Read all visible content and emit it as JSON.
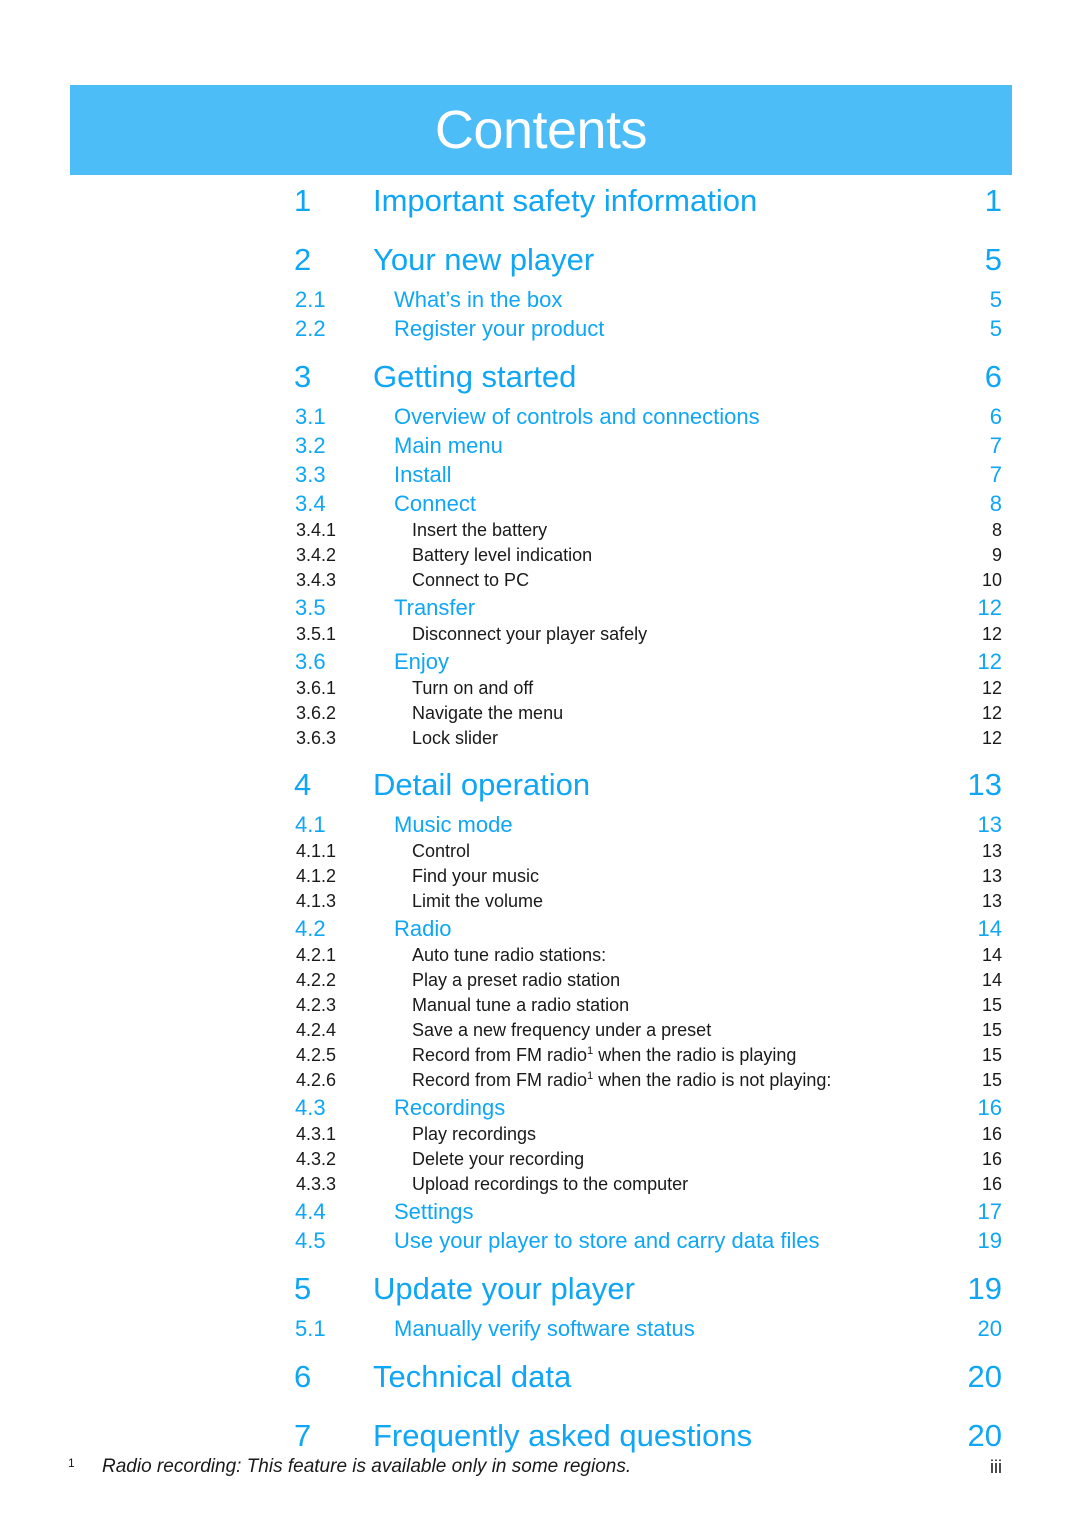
{
  "header": {
    "title": "Contents",
    "band_color": "#4dbdf7",
    "title_color": "#ffffff"
  },
  "colors": {
    "accent_blue": "#0fa6f5",
    "header_blue": "#4dbdf7",
    "body_black": "#1a1a1a"
  },
  "toc": {
    "entries": [
      {
        "level": 1,
        "number": "1",
        "label": "Important safety information",
        "page": "1",
        "gap_before": false
      },
      {
        "level": 1,
        "number": "2",
        "label": "Your new player",
        "page": "5",
        "gap_before": true
      },
      {
        "level": 2,
        "number": "2.1",
        "label": "What’s in the box",
        "page": "5",
        "gap_before": false
      },
      {
        "level": 2,
        "number": "2.2",
        "label": "Register your product",
        "page": "5",
        "gap_before": false
      },
      {
        "level": 1,
        "number": "3",
        "label": "Getting started",
        "page": "6",
        "gap_before": true
      },
      {
        "level": 2,
        "number": "3.1",
        "label": "Overview of controls and connections",
        "page": "6",
        "gap_before": false
      },
      {
        "level": 2,
        "number": "3.2",
        "label": "Main menu",
        "page": "7",
        "gap_before": false
      },
      {
        "level": 2,
        "number": "3.3",
        "label": "Install",
        "page": "7",
        "gap_before": false
      },
      {
        "level": 2,
        "number": "3.4",
        "label": "Connect",
        "page": "8",
        "gap_before": false
      },
      {
        "level": 3,
        "number": "3.4.1",
        "label": "Insert the battery",
        "page": "8",
        "gap_before": false
      },
      {
        "level": 3,
        "number": "3.4.2",
        "label": "Battery level indication",
        "page": "9",
        "gap_before": false
      },
      {
        "level": 3,
        "number": "3.4.3",
        "label": "Connect to PC",
        "page": "10",
        "gap_before": false
      },
      {
        "level": 2,
        "number": "3.5",
        "label": "Transfer",
        "page": "12",
        "gap_before": false
      },
      {
        "level": 3,
        "number": "3.5.1",
        "label": "Disconnect your player safely",
        "page": "12",
        "gap_before": false
      },
      {
        "level": 2,
        "number": "3.6",
        "label": "Enjoy",
        "page": "12",
        "gap_before": false
      },
      {
        "level": 3,
        "number": "3.6.1",
        "label": "Turn on and off",
        "page": "12",
        "gap_before": false
      },
      {
        "level": 3,
        "number": "3.6.2",
        "label": "Navigate the menu",
        "page": "12",
        "gap_before": false
      },
      {
        "level": 3,
        "number": "3.6.3",
        "label": "Lock slider",
        "page": "12",
        "gap_before": false
      },
      {
        "level": 1,
        "number": "4",
        "label": "Detail operation",
        "page": "13",
        "gap_before": true
      },
      {
        "level": 2,
        "number": "4.1",
        "label": "Music mode",
        "page": "13",
        "gap_before": false
      },
      {
        "level": 3,
        "number": "4.1.1",
        "label": "Control",
        "page": "13",
        "gap_before": false
      },
      {
        "level": 3,
        "number": "4.1.2",
        "label": "Find your music",
        "page": "13",
        "gap_before": false
      },
      {
        "level": 3,
        "number": "4.1.3",
        "label": "Limit the volume",
        "page": "13",
        "gap_before": false
      },
      {
        "level": 2,
        "number": "4.2",
        "label": "Radio",
        "page": "14",
        "gap_before": false
      },
      {
        "level": 3,
        "number": "4.2.1",
        "label": "Auto tune radio stations:",
        "page": "14",
        "gap_before": false
      },
      {
        "level": 3,
        "number": "4.2.2",
        "label": "Play a preset radio station",
        "page": "14",
        "gap_before": false
      },
      {
        "level": 3,
        "number": "4.2.3",
        "label": "Manual tune a radio station",
        "page": "15",
        "gap_before": false
      },
      {
        "level": 3,
        "number": "4.2.4",
        "label": "Save a new frequency under a preset",
        "page": "15",
        "gap_before": false
      },
      {
        "level": 3,
        "number": "4.2.5",
        "label": "Record from FM radio",
        "footnote": "1",
        "label_after": " when the radio is playing",
        "page": "15",
        "gap_before": false
      },
      {
        "level": 3,
        "number": "4.2.6",
        "label": "Record from FM radio",
        "footnote": "1",
        "label_after": " when the radio is not playing:",
        "page": "15",
        "gap_before": false
      },
      {
        "level": 2,
        "number": "4.3",
        "label": "Recordings",
        "page": "16",
        "gap_before": false
      },
      {
        "level": 3,
        "number": "4.3.1",
        "label": "Play recordings",
        "page": "16",
        "gap_before": false
      },
      {
        "level": 3,
        "number": "4.3.2",
        "label": "Delete your recording",
        "page": "16",
        "gap_before": false
      },
      {
        "level": 3,
        "number": "4.3.3",
        "label": "Upload recordings to the computer",
        "page": "16",
        "gap_before": false
      },
      {
        "level": 2,
        "number": "4.4",
        "label": "Settings",
        "page": "17",
        "gap_before": false
      },
      {
        "level": 2,
        "number": "4.5",
        "label": "Use your player to store and carry data files",
        "page": "19",
        "gap_before": false
      },
      {
        "level": 1,
        "number": "5",
        "label": "Update your player",
        "page": "19",
        "gap_before": true
      },
      {
        "level": 2,
        "number": "5.1",
        "label": "Manually verify software status",
        "page": "20",
        "gap_before": false
      },
      {
        "level": 1,
        "number": "6",
        "label": "Technical data",
        "page": "20",
        "gap_before": true
      },
      {
        "level": 1,
        "number": "7",
        "label": "Frequently asked questions",
        "page": "20",
        "gap_before": true
      }
    ]
  },
  "footnote": {
    "marker": "1",
    "text": "Radio recording: This feature is available only in some regions.",
    "page": "iii"
  }
}
